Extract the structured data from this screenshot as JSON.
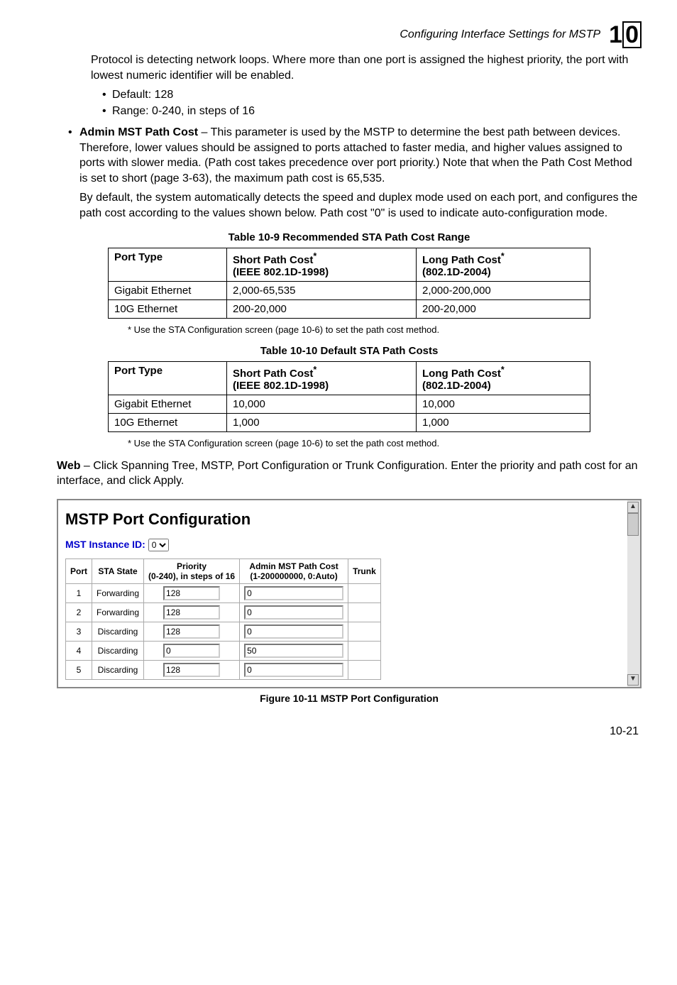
{
  "header": {
    "section_title": "Configuring Interface Settings for MSTP",
    "chapter_number": "1",
    "chapter_letter": "0"
  },
  "intro": {
    "para1": "Protocol is detecting network loops. Where more than one port is assigned the highest priority, the port with lowest numeric identifier will be enabled.",
    "bullet1": "Default: 128",
    "bullet2": "Range: 0-240, in steps of 16",
    "admin_label": "Admin MST Path Cost",
    "admin_text": " – This parameter is used by the MSTP to determine the best path between devices. Therefore, lower values should be assigned to ports attached to faster media, and higher values assigned to ports with slower media. (Path cost takes precedence over port priority.) Note that when the Path Cost Method is set to short (page 3-63), the maximum path cost is 65,535.",
    "admin_para2": "By default, the system automatically detects the speed and duplex mode used on each port, and configures the path cost according to the values shown below. Path cost \"0\" is used to indicate auto-configuration mode."
  },
  "table1": {
    "caption": "Table 10-9   Recommended STA Path Cost Range",
    "h1": "Port Type",
    "h2a": "Short Path Cost",
    "h2b": "(IEEE 802.1D-1998)",
    "h3a": "Long Path Cost",
    "h3b": "(802.1D-2004)",
    "r1c1": "Gigabit Ethernet",
    "r1c2": "2,000-65,535",
    "r1c3": "2,000-200,000",
    "r2c1": "10G Ethernet",
    "r2c2": "200-20,000",
    "r2c3": "200-20,000"
  },
  "footnote1": "*   Use the STA Configuration screen (page 10-6) to set the path cost method.",
  "table2": {
    "caption": "Table 10-10   Default STA Path Costs",
    "h1": "Port Type",
    "h2a": "Short Path Cost",
    "h2b": "(IEEE 802.1D-1998)",
    "h3a": "Long Path Cost",
    "h3b": "(802.1D-2004)",
    "r1c1": "Gigabit Ethernet",
    "r1c2": "10,000",
    "r1c3": "10,000",
    "r2c1": "10G Ethernet",
    "r2c2": "1,000",
    "r2c3": "1,000"
  },
  "footnote2": "*   Use the STA Configuration screen (page 10-6) to set the path cost method.",
  "web_para_strong": "Web",
  "web_para_rest": " – Click Spanning Tree, MSTP, Port Configuration or Trunk Configuration. Enter the priority and path cost for an interface, and click Apply.",
  "screenshot": {
    "title": "MSTP Port Configuration",
    "mst_label": "MST Instance ID: ",
    "mst_value": "0",
    "th_port": "Port",
    "th_state": "STA State",
    "th_prio1": "Priority",
    "th_prio2": "(0-240), in steps of 16",
    "th_path1": "Admin MST Path Cost",
    "th_path2": "(1-200000000, 0:Auto)",
    "th_trunk": "Trunk",
    "rows": [
      {
        "port": "1",
        "state": "Forwarding",
        "prio": "128",
        "path": "0",
        "trunk": ""
      },
      {
        "port": "2",
        "state": "Forwarding",
        "prio": "128",
        "path": "0",
        "trunk": ""
      },
      {
        "port": "3",
        "state": "Discarding",
        "prio": "128",
        "path": "0",
        "trunk": ""
      },
      {
        "port": "4",
        "state": "Discarding",
        "prio": "0",
        "path": "50",
        "trunk": ""
      },
      {
        "port": "5",
        "state": "Discarding",
        "prio": "128",
        "path": "0",
        "trunk": ""
      }
    ]
  },
  "fig_caption": "Figure 10-11   MSTP Port Configuration",
  "page_number": "10-21"
}
